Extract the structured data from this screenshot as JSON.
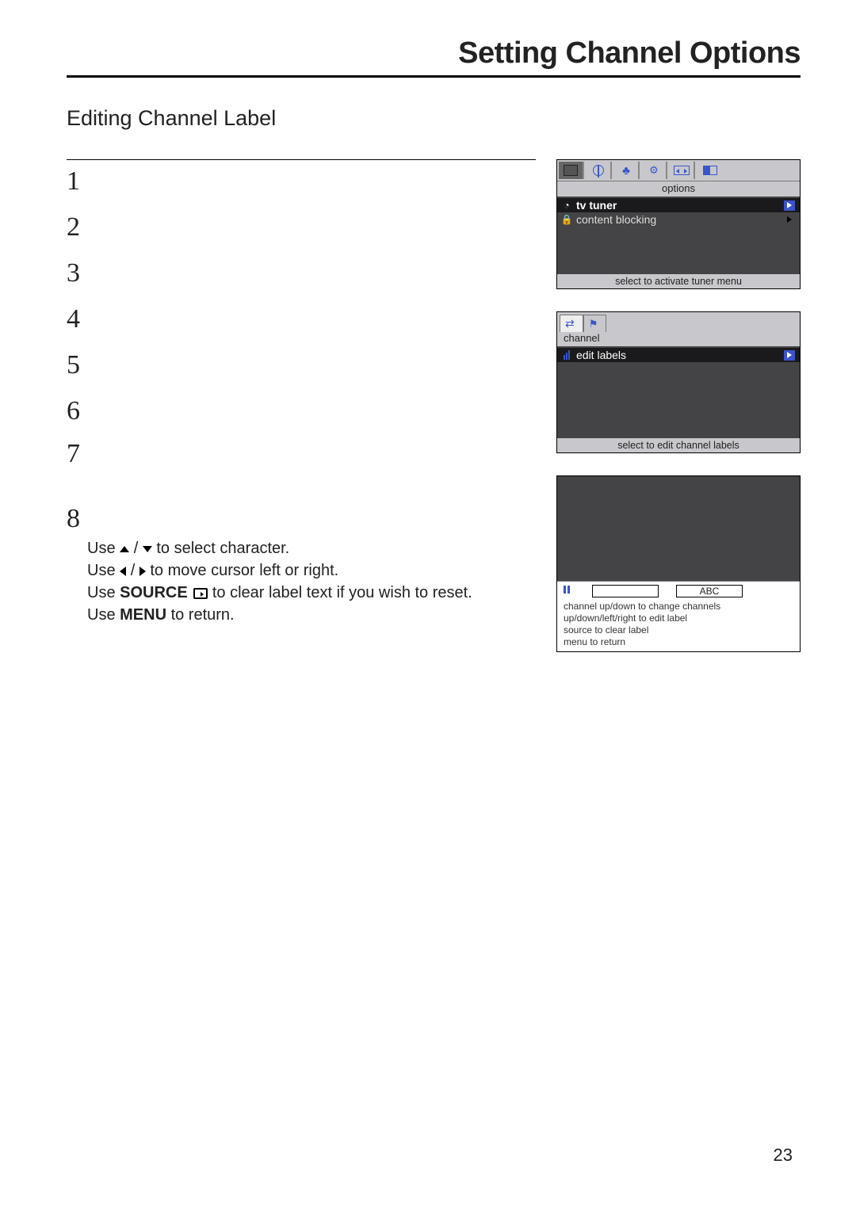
{
  "title": "Setting Channel Options",
  "subtitle": "Editing Channel Label",
  "steps": [
    "1",
    "2",
    "3",
    "4",
    "5",
    "6",
    "7",
    "8"
  ],
  "step8": {
    "line1_pre": "Use ",
    "line1_post": " to select character.",
    "line2_pre": "Use ",
    "line2_post": " to move cursor left or right.",
    "line3_a": "Use ",
    "line3_b": "SOURCE",
    "line3_c": "  to clear label text if you wish to reset.",
    "line4_a": "Use ",
    "line4_b": "MENU",
    "line4_c": " to return."
  },
  "osd1": {
    "caption": "options",
    "items": [
      {
        "icon": "clock",
        "label": "tv tuner",
        "selected": true,
        "arrow": true
      },
      {
        "icon": "lock",
        "label": "content blocking",
        "selected": false,
        "arrow": true
      }
    ],
    "hint": "select to activate tuner menu"
  },
  "osd2": {
    "caption": "channel",
    "items": [
      {
        "icon": "bars",
        "label": "edit labels",
        "selected": true,
        "arrow": true
      }
    ],
    "hint": "select to edit channel labels"
  },
  "osd3": {
    "ch_value": "",
    "label_value": "ABC",
    "help": [
      "channel up/down to change channels",
      "up/down/left/right to edit label",
      "source to clear label",
      "menu to return"
    ]
  },
  "page_number": "23"
}
